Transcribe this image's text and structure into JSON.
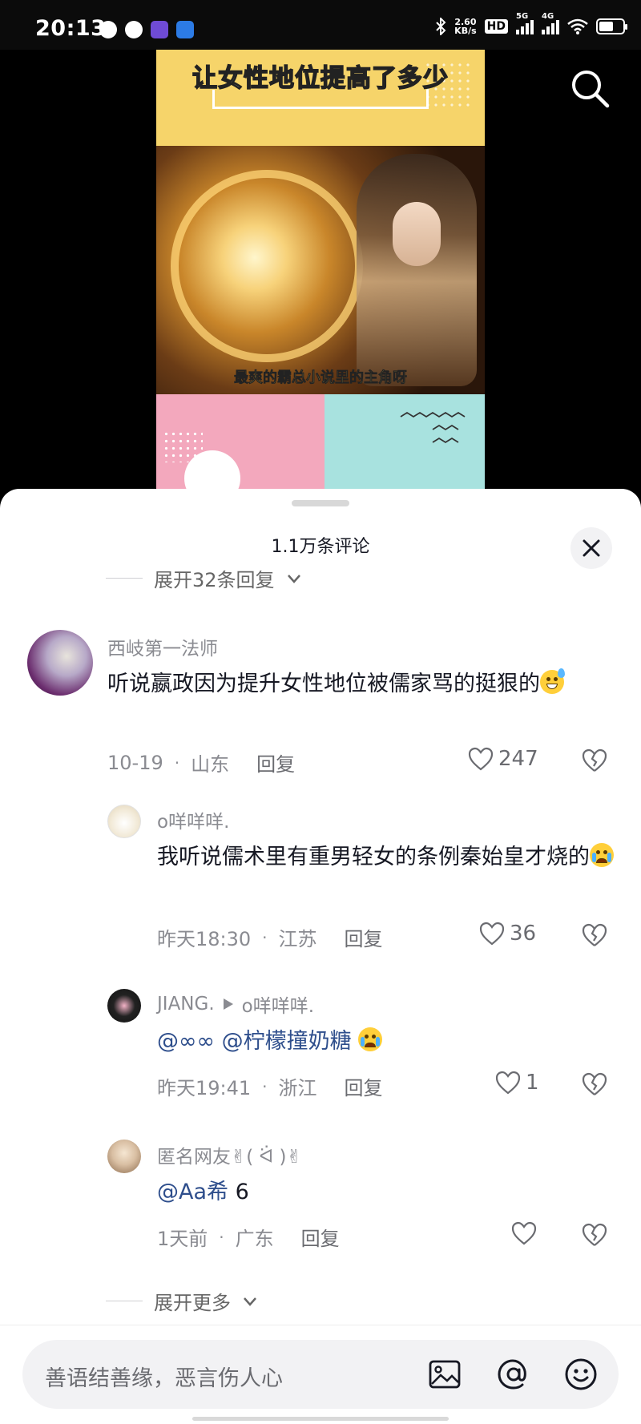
{
  "status_bar": {
    "time": "20:13",
    "net_speed_value": "2.60",
    "net_speed_unit": "KB/s",
    "hd_label": "HD",
    "signal_1_label": "5G",
    "signal_2_label": "4G",
    "battery_level": 0.62
  },
  "video": {
    "title_text": "让女性地位提高了多少",
    "caption_text": "最爽的霸总小说里的主角呀"
  },
  "comments_sheet": {
    "title": "1.1万条评论",
    "expand_replies_label": "展开32条回复",
    "expand_more_label": "展开更多",
    "comments": [
      {
        "username": "西岐第一法师",
        "text": "听说嬴政因为提升女性地位被儒家骂的挺狠的",
        "date": "10-19",
        "location": "山东",
        "reply_label": "回复",
        "likes": "247"
      },
      {
        "username": "o咩咩咩.",
        "text": "我听说儒术里有重男轻女的条例秦始皇才烧的",
        "date": "昨天18:30",
        "location": "江苏",
        "reply_label": "回复",
        "likes": "36"
      },
      {
        "username": "JIANG.",
        "reply_to": "o咩咩咩.",
        "mention_1": "@∞∞",
        "mention_2": "@柠檬撞奶糖",
        "date": "昨天19:41",
        "location": "浙江",
        "reply_label": "回复",
        "likes": "1"
      },
      {
        "username": "匿名网友✌( ᐛ )✌",
        "mention_1": "@Aa希",
        "text_after": "6",
        "date": "1天前",
        "location": "广东",
        "reply_label": "回复",
        "likes": ""
      }
    ]
  },
  "input_bar": {
    "placeholder": "善语结善缘，恶言伤人心"
  },
  "colors": {
    "mention": "#2e4e8c",
    "secondary_text": "#8a8b91",
    "sheet_bg": "#ffffff"
  }
}
